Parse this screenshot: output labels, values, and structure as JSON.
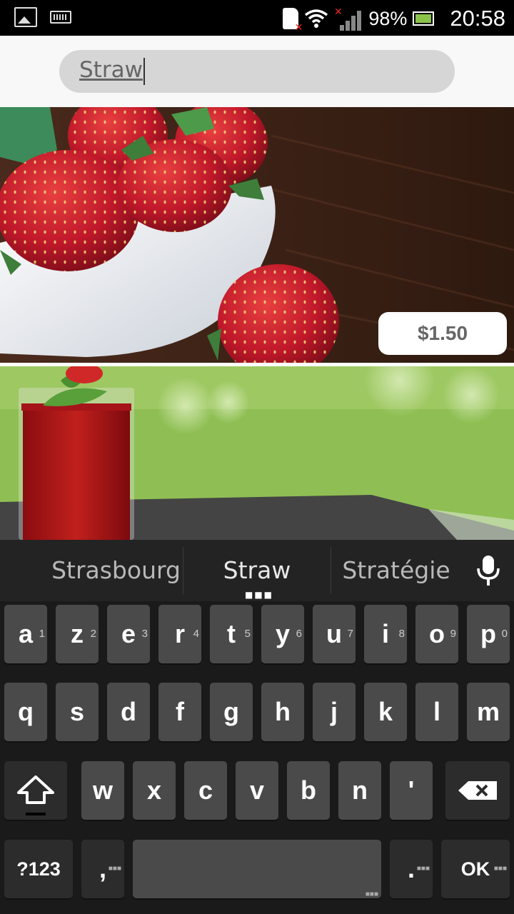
{
  "status_bar": {
    "icons_left": [
      "gallery-icon",
      "keyboard-icon"
    ],
    "icons_right": [
      "sim-error-icon",
      "wifi-icon",
      "signal-icon",
      "battery-icon"
    ],
    "battery_percent": "98%",
    "time": "20:58"
  },
  "search": {
    "value": "Straw"
  },
  "products": [
    {
      "image": "strawberries in white bowl",
      "price": "$1.50"
    },
    {
      "image": "strawberry smoothie glass"
    }
  ],
  "keyboard": {
    "suggestions": [
      "Strasbourg",
      "Straw",
      "Stratégie"
    ],
    "row1": [
      {
        "label": "a",
        "sub": "1"
      },
      {
        "label": "z",
        "sub": "2"
      },
      {
        "label": "e",
        "sub": "3"
      },
      {
        "label": "r",
        "sub": "4"
      },
      {
        "label": "t",
        "sub": "5"
      },
      {
        "label": "y",
        "sub": "6"
      },
      {
        "label": "u",
        "sub": "7"
      },
      {
        "label": "i",
        "sub": "8"
      },
      {
        "label": "o",
        "sub": "9"
      },
      {
        "label": "p",
        "sub": "0"
      }
    ],
    "row2": [
      "q",
      "s",
      "d",
      "f",
      "g",
      "h",
      "j",
      "k",
      "l",
      "m"
    ],
    "row3": [
      "w",
      "x",
      "c",
      "v",
      "b",
      "n",
      "'"
    ],
    "symbols_label": "?123",
    "comma_label": ",",
    "period_label": ".",
    "ok_label": "OK",
    "colors": {
      "key": "#4a4a4a",
      "key_dark": "#2c2c2c",
      "background": "#1a1a1a"
    }
  }
}
